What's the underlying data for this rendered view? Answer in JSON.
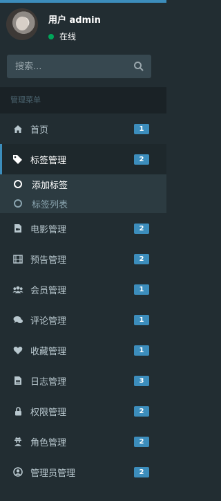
{
  "user": {
    "name": "用户 admin",
    "status": "在线"
  },
  "search": {
    "placeholder": "搜索..."
  },
  "menu_header": "管理菜单",
  "menu": [
    {
      "label": "首页",
      "badge": "1",
      "icon": "home-icon"
    },
    {
      "label": "标签管理",
      "badge": "2",
      "icon": "tags-icon"
    },
    {
      "label": "电影管理",
      "badge": "2",
      "icon": "file-video-icon"
    },
    {
      "label": "预告管理",
      "badge": "2",
      "icon": "film-icon"
    },
    {
      "label": "会员管理",
      "badge": "1",
      "icon": "users-icon"
    },
    {
      "label": "评论管理",
      "badge": "1",
      "icon": "comments-icon"
    },
    {
      "label": "收藏管理",
      "badge": "1",
      "icon": "heart-icon"
    },
    {
      "label": "日志管理",
      "badge": "3",
      "icon": "file-text-icon"
    },
    {
      "label": "权限管理",
      "badge": "2",
      "icon": "lock-icon"
    },
    {
      "label": "角色管理",
      "badge": "2",
      "icon": "user-secret-icon"
    },
    {
      "label": "管理员管理",
      "badge": "2",
      "icon": "user-circle-icon"
    }
  ],
  "submenu": [
    {
      "label": "添加标签"
    },
    {
      "label": "标签列表"
    }
  ],
  "colors": {
    "sidebar_bg": "#222d32",
    "accent": "#3c8dbc",
    "online": "#00a65a"
  }
}
